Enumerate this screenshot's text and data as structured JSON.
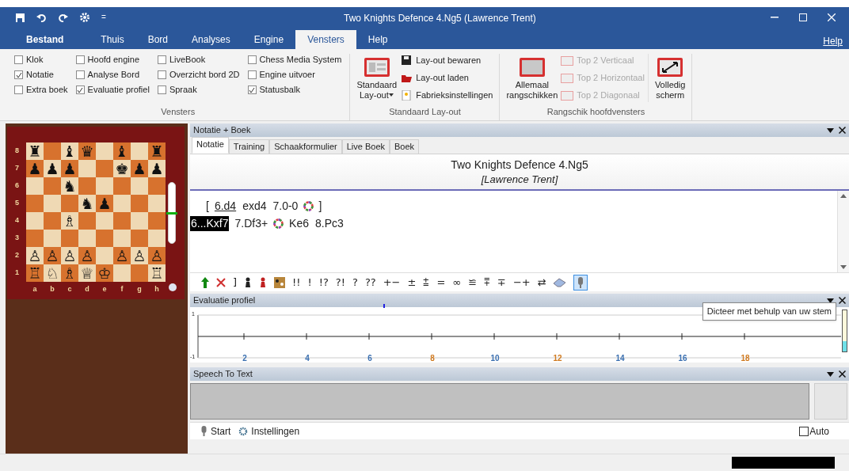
{
  "window": {
    "title": "Two Knights Defence 4.Ng5  (Lawrence Trent)",
    "quick_access_more": "="
  },
  "ribbon_tabs": [
    {
      "label": "Bestand",
      "kind": "file",
      "selected": false
    },
    {
      "label": "Thuis",
      "kind": "tab",
      "selected": false
    },
    {
      "label": "Bord",
      "kind": "tab",
      "selected": false
    },
    {
      "label": "Analyses",
      "kind": "tab",
      "selected": false
    },
    {
      "label": "Engine",
      "kind": "tab",
      "selected": false
    },
    {
      "label": "Vensters",
      "kind": "tab",
      "selected": true
    },
    {
      "label": "Help",
      "kind": "tab",
      "selected": false
    }
  ],
  "help_link": "Help",
  "vensters_group": {
    "label": "Vensters",
    "columns": [
      [
        {
          "label": "Klok",
          "checked": false
        },
        {
          "label": "Notatie",
          "checked": true
        },
        {
          "label": "Extra boek",
          "checked": false
        }
      ],
      [
        {
          "label": "Hoofd engine",
          "checked": false
        },
        {
          "label": "Analyse Bord",
          "checked": false
        },
        {
          "label": "Evaluatie profiel",
          "checked": true
        }
      ],
      [
        {
          "label": "LiveBook",
          "checked": false
        },
        {
          "label": "Overzicht bord 2D",
          "checked": false
        },
        {
          "label": "Spraak",
          "checked": false
        }
      ],
      [
        {
          "label": "Chess Media System",
          "checked": false
        },
        {
          "label": "Engine uitvoer",
          "checked": false
        },
        {
          "label": "Statusbalk",
          "checked": true
        }
      ]
    ]
  },
  "layout_group": {
    "label": "Standaard Lay-out",
    "big_button": [
      "Standaard",
      "Lay-out"
    ],
    "items": [
      {
        "label": "Lay-out bewaren",
        "kind": "save"
      },
      {
        "label": "Lay-out laden",
        "kind": "open"
      },
      {
        "label": "Fabrieksinstellingen",
        "kind": "reset"
      }
    ]
  },
  "arrange_group": {
    "label": "Rangschik hoofdvensters",
    "big_button": [
      "Allemaal",
      "rangschikken"
    ],
    "items": [
      {
        "label": "Top 2 Verticaal",
        "disabled": true
      },
      {
        "label": "Top 2 Horizontaal",
        "disabled": true
      },
      {
        "label": "Top 2 Diagonaal",
        "disabled": true
      }
    ],
    "fullscreen_button": [
      "Volledig",
      "scherm"
    ]
  },
  "board": {
    "ranks": [
      "8",
      "7",
      "6",
      "5",
      "4",
      "3",
      "2",
      "1"
    ],
    "files": [
      "a",
      "b",
      "c",
      "d",
      "e",
      "f",
      "g",
      "h"
    ],
    "rows": [
      [
        {
          "kind": "piece",
          "glyph": "♜"
        },
        {
          "kind": "empty"
        },
        {
          "kind": "piece",
          "glyph": "♝"
        },
        {
          "kind": "piece",
          "glyph": "♛"
        },
        {
          "kind": "empty"
        },
        {
          "kind": "piece",
          "glyph": "♝"
        },
        {
          "kind": "empty"
        },
        {
          "kind": "piece",
          "glyph": "♜"
        }
      ],
      [
        {
          "kind": "piece",
          "glyph": "♟"
        },
        {
          "kind": "piece",
          "glyph": "♟"
        },
        {
          "kind": "piece",
          "glyph": "♟"
        },
        {
          "kind": "empty"
        },
        {
          "kind": "empty"
        },
        {
          "kind": "piece",
          "glyph": "♚"
        },
        {
          "kind": "piece",
          "glyph": "♟"
        },
        {
          "kind": "piece",
          "glyph": "♟"
        }
      ],
      [
        {
          "kind": "empty"
        },
        {
          "kind": "empty"
        },
        {
          "kind": "piece",
          "glyph": "♞"
        },
        {
          "kind": "empty"
        },
        {
          "kind": "empty"
        },
        {
          "kind": "empty"
        },
        {
          "kind": "empty"
        },
        {
          "kind": "empty"
        }
      ],
      [
        {
          "kind": "empty"
        },
        {
          "kind": "empty"
        },
        {
          "kind": "empty"
        },
        {
          "kind": "piece",
          "glyph": "♞"
        },
        {
          "kind": "piece",
          "glyph": "♟"
        },
        {
          "kind": "empty"
        },
        {
          "kind": "empty"
        },
        {
          "kind": "empty"
        }
      ],
      [
        {
          "kind": "empty"
        },
        {
          "kind": "empty"
        },
        {
          "kind": "piece",
          "glyph": "♗"
        },
        {
          "kind": "empty"
        },
        {
          "kind": "empty"
        },
        {
          "kind": "empty"
        },
        {
          "kind": "empty"
        },
        {
          "kind": "empty"
        }
      ],
      [
        {
          "kind": "empty"
        },
        {
          "kind": "empty"
        },
        {
          "kind": "empty"
        },
        {
          "kind": "empty"
        },
        {
          "kind": "empty"
        },
        {
          "kind": "empty"
        },
        {
          "kind": "empty"
        },
        {
          "kind": "empty"
        }
      ],
      [
        {
          "kind": "piece",
          "glyph": "♙"
        },
        {
          "kind": "piece",
          "glyph": "♙"
        },
        {
          "kind": "piece",
          "glyph": "♙"
        },
        {
          "kind": "piece",
          "glyph": "♙"
        },
        {
          "kind": "empty"
        },
        {
          "kind": "piece",
          "glyph": "♙"
        },
        {
          "kind": "piece",
          "glyph": "♙"
        },
        {
          "kind": "piece",
          "glyph": "♙"
        }
      ],
      [
        {
          "kind": "piece",
          "glyph": "♖"
        },
        {
          "kind": "piece",
          "glyph": "♘"
        },
        {
          "kind": "piece",
          "glyph": "♗"
        },
        {
          "kind": "piece",
          "glyph": "♕"
        },
        {
          "kind": "piece",
          "glyph": "♔"
        },
        {
          "kind": "empty"
        },
        {
          "kind": "empty"
        },
        {
          "kind": "piece",
          "glyph": "♖"
        }
      ]
    ],
    "evaluation": {
      "level": 0.5
    }
  },
  "notation": {
    "title": "Notatie + Boek",
    "tabs": [
      {
        "label": "Notatie",
        "selected": true
      },
      {
        "label": "Training",
        "selected": false
      },
      {
        "label": "Schaakformulier",
        "selected": false
      },
      {
        "label": "Live Boek",
        "selected": false
      },
      {
        "label": "Boek",
        "selected": false
      }
    ],
    "game_title": "Two Knights Defence 4.Ng5",
    "game_author": "[Lawrence Trent]",
    "lines": [
      [
        {
          "kind": "text",
          "text": "["
        },
        {
          "kind": "move",
          "text": "6.d4",
          "selected": false,
          "underlined": true
        },
        {
          "kind": "move",
          "text": "exd4",
          "selected": false,
          "underlined": false
        },
        {
          "kind": "move",
          "text": "7.0-0",
          "selected": false,
          "underlined": false
        },
        {
          "kind": "symbol"
        },
        {
          "kind": "text",
          "text": "]"
        }
      ],
      [
        {
          "kind": "move",
          "text": "6...Kxf7",
          "selected": true,
          "underlined": false
        },
        {
          "kind": "move",
          "text": "7.Df3+",
          "selected": false,
          "underlined": false
        },
        {
          "kind": "symbol"
        },
        {
          "kind": "move",
          "text": "Ke6",
          "selected": false,
          "underlined": false
        },
        {
          "kind": "move",
          "text": "8.Pc3",
          "selected": false,
          "underlined": false
        }
      ]
    ],
    "toolbar": [
      {
        "kind": "arrow-up-icon"
      },
      {
        "kind": "cross-icon"
      },
      {
        "kind": "glyph",
        "text": "]"
      },
      {
        "kind": "pawn-icon"
      },
      {
        "kind": "red-pawn-icon"
      },
      {
        "kind": "pieces-icon"
      },
      {
        "kind": "glyph",
        "text": "!!"
      },
      {
        "kind": "glyph",
        "text": "!"
      },
      {
        "kind": "glyph",
        "text": "!?"
      },
      {
        "kind": "glyph",
        "text": "?!"
      },
      {
        "kind": "glyph",
        "text": "?"
      },
      {
        "kind": "glyph",
        "text": "??"
      },
      {
        "kind": "glyph",
        "text": "+−"
      },
      {
        "kind": "glyph",
        "text": "±"
      },
      {
        "kind": "glyph",
        "text": "⩲"
      },
      {
        "kind": "glyph",
        "text": "="
      },
      {
        "kind": "glyph",
        "text": "∞"
      },
      {
        "kind": "glyph",
        "text": "≌"
      },
      {
        "kind": "glyph",
        "text": "⩱"
      },
      {
        "kind": "glyph",
        "text": "∓"
      },
      {
        "kind": "glyph",
        "text": "−+"
      },
      {
        "kind": "glyph",
        "text": "⇄"
      },
      {
        "kind": "eraser-icon"
      },
      {
        "kind": "microphone-icon",
        "selected": true
      }
    ]
  },
  "tooltip": "Dicteer met behulp van uw stem",
  "eval_profile": {
    "title": "Evaluatie profiel",
    "y_labels": [
      "1",
      "-1"
    ],
    "x_labels": [
      {
        "text": "2",
        "color": "#3a6fb0"
      },
      {
        "text": "4",
        "color": "#3a6fb0"
      },
      {
        "text": "6",
        "color": "#3a6fb0"
      },
      {
        "text": "8",
        "color": "#d07a20"
      },
      {
        "text": "10",
        "color": "#3a6fb0"
      },
      {
        "text": "12",
        "color": "#d07a20"
      },
      {
        "text": "14",
        "color": "#3a6fb0"
      },
      {
        "text": "16",
        "color": "#3a6fb0"
      },
      {
        "text": "18",
        "color": "#d07a20"
      }
    ]
  },
  "speech": {
    "title": "Speech To Text",
    "start": "Start",
    "settings": "Instellingen",
    "auto": {
      "label": "Auto",
      "checked": false
    }
  }
}
